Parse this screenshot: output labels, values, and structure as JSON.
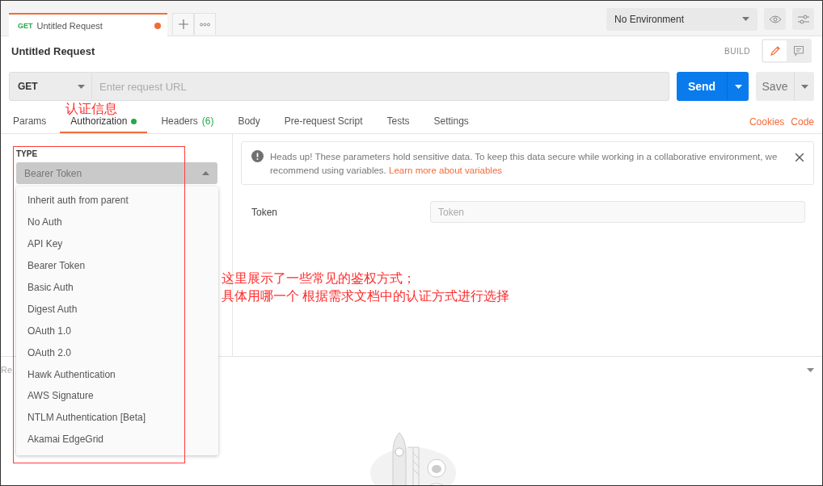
{
  "request_tab": {
    "method": "GET",
    "title": "Untitled Request",
    "unsaved": true
  },
  "environment": {
    "value": "No Environment"
  },
  "request_title": "Untitled Request",
  "mode": {
    "label": "BUILD",
    "options": [
      {
        "kind": "edit",
        "selected": true
      },
      {
        "kind": "comment",
        "selected": false
      }
    ]
  },
  "url_bar": {
    "method": "GET",
    "placeholder": "Enter request URL"
  },
  "send_button": "Send",
  "save_button": "Save",
  "request_tabs": [
    {
      "label": "Params",
      "selected": false,
      "dot": false
    },
    {
      "label": "Authorization",
      "selected": true,
      "dot": true
    },
    {
      "label": "Headers",
      "count": "(6)",
      "selected": false,
      "dot": false
    },
    {
      "label": "Body",
      "selected": false,
      "dot": false
    },
    {
      "label": "Pre-request Script",
      "selected": false,
      "dot": false
    },
    {
      "label": "Tests",
      "selected": false,
      "dot": false
    },
    {
      "label": "Settings",
      "selected": false,
      "dot": false
    }
  ],
  "links": [
    "Cookies",
    "Code"
  ],
  "auth": {
    "type_label": "TYPE",
    "value": "Bearer Token",
    "expanded": true,
    "options": [
      "Inherit auth from parent",
      "No Auth",
      "API Key",
      "Bearer Token",
      "Basic Auth",
      "Digest Auth",
      "OAuth 1.0",
      "OAuth 2.0",
      "Hawk Authentication",
      "AWS Signature",
      "NTLM Authentication [Beta]",
      "Akamai EdgeGrid"
    ]
  },
  "alert": {
    "message": "Heads up! These parameters hold sensitive data. To keep this data secure while working in a collaborative environment, we recommend using variables.",
    "link": "Learn more about variables"
  },
  "token_field": {
    "label": "Token",
    "placeholder": "Token"
  },
  "response": {
    "label": "Re"
  },
  "annotations": {
    "tab_note": "认证信息",
    "note_lines": [
      "这里展示了一些常见的鉴权方式；",
      "具体用哪一个 根据需求文档中的认证方式进行选择"
    ]
  }
}
